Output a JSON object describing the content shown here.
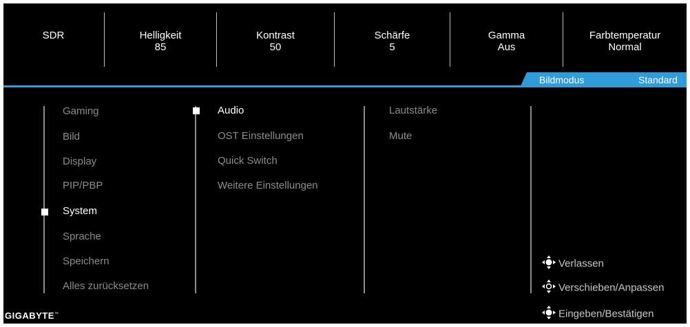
{
  "header": {
    "cells": [
      {
        "label": "SDR",
        "value": ""
      },
      {
        "label": "Helligkeit",
        "value": "85"
      },
      {
        "label": "Kontrast",
        "value": "50"
      },
      {
        "label": "Schärfe",
        "value": "5"
      },
      {
        "label": "Gamma",
        "value": "Aus"
      },
      {
        "label": "Farbtemperatur",
        "value": "Normal"
      }
    ],
    "mode_label": "Bildmodus",
    "mode_value": "Standard"
  },
  "menu": {
    "main": [
      "Gaming",
      "Bild",
      "Display",
      "PIP/PBP",
      "System",
      "Sprache",
      "Speichern",
      "Alles zurücksetzen"
    ],
    "main_selected": "System",
    "sub": [
      "Audio",
      "OST Einstellungen",
      "Quick Switch",
      "Weitere Einstellungen"
    ],
    "sub_selected": "Audio",
    "options": [
      "Lautstärke",
      "Mute"
    ]
  },
  "hints": {
    "exit": "Verlassen",
    "move": "Verschieben/Anpassen",
    "enter": "Eingeben/Bestätigen"
  },
  "brand": {
    "logo": "GIGABYTE",
    "tm": "™"
  },
  "colors": {
    "accent": "#2f9bd8",
    "inactive_text": "#8c8c8c",
    "active_text": "#ffffff"
  },
  "icons": {
    "hint_icon": "joystick-icon"
  }
}
